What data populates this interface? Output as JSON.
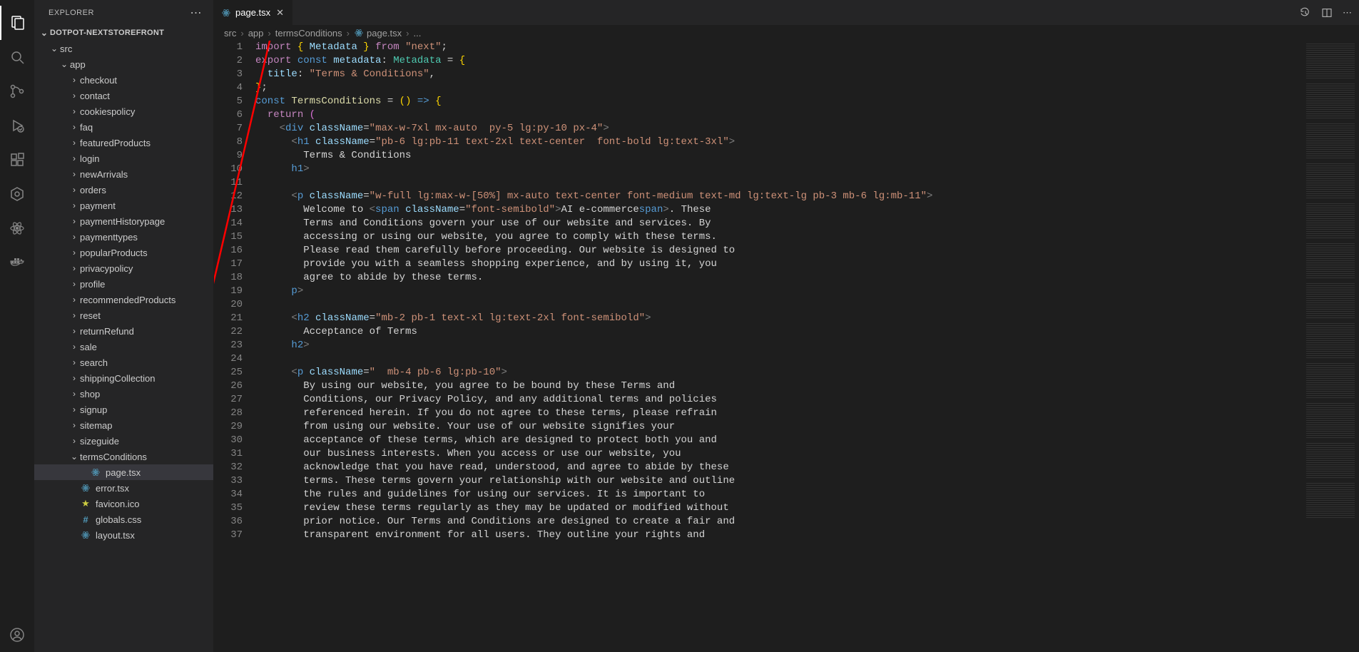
{
  "explorer": {
    "title": "EXPLORER",
    "project": "DOTPOT-NEXTSTOREFRONT",
    "tree": [
      {
        "label": "src",
        "depth": 1,
        "kind": "folder",
        "expanded": true
      },
      {
        "label": "app",
        "depth": 2,
        "kind": "folder",
        "expanded": true
      },
      {
        "label": "checkout",
        "depth": 3,
        "kind": "folder"
      },
      {
        "label": "contact",
        "depth": 3,
        "kind": "folder"
      },
      {
        "label": "cookiespolicy",
        "depth": 3,
        "kind": "folder"
      },
      {
        "label": "faq",
        "depth": 3,
        "kind": "folder"
      },
      {
        "label": "featuredProducts",
        "depth": 3,
        "kind": "folder"
      },
      {
        "label": "login",
        "depth": 3,
        "kind": "folder"
      },
      {
        "label": "newArrivals",
        "depth": 3,
        "kind": "folder"
      },
      {
        "label": "orders",
        "depth": 3,
        "kind": "folder"
      },
      {
        "label": "payment",
        "depth": 3,
        "kind": "folder"
      },
      {
        "label": "paymentHistorypage",
        "depth": 3,
        "kind": "folder"
      },
      {
        "label": "paymenttypes",
        "depth": 3,
        "kind": "folder"
      },
      {
        "label": "popularProducts",
        "depth": 3,
        "kind": "folder"
      },
      {
        "label": "privacypolicy",
        "depth": 3,
        "kind": "folder"
      },
      {
        "label": "profile",
        "depth": 3,
        "kind": "folder"
      },
      {
        "label": "recommendedProducts",
        "depth": 3,
        "kind": "folder"
      },
      {
        "label": "reset",
        "depth": 3,
        "kind": "folder"
      },
      {
        "label": "returnRefund",
        "depth": 3,
        "kind": "folder"
      },
      {
        "label": "sale",
        "depth": 3,
        "kind": "folder"
      },
      {
        "label": "search",
        "depth": 3,
        "kind": "folder"
      },
      {
        "label": "shippingCollection",
        "depth": 3,
        "kind": "folder"
      },
      {
        "label": "shop",
        "depth": 3,
        "kind": "folder"
      },
      {
        "label": "signup",
        "depth": 3,
        "kind": "folder"
      },
      {
        "label": "sitemap",
        "depth": 3,
        "kind": "folder"
      },
      {
        "label": "sizeguide",
        "depth": 3,
        "kind": "folder"
      },
      {
        "label": "termsConditions",
        "depth": 3,
        "kind": "folder",
        "expanded": true
      },
      {
        "label": "page.tsx",
        "depth": 4,
        "kind": "react",
        "selected": true
      },
      {
        "label": "error.tsx",
        "depth": 3,
        "kind": "react"
      },
      {
        "label": "favicon.ico",
        "depth": 3,
        "kind": "favicon"
      },
      {
        "label": "globals.css",
        "depth": 3,
        "kind": "css"
      },
      {
        "label": "layout.tsx",
        "depth": 3,
        "kind": "react"
      }
    ]
  },
  "tab": {
    "label": "page.tsx"
  },
  "breadcrumbs": [
    "src",
    "app",
    "termsConditions",
    "page.tsx",
    "..."
  ],
  "code": {
    "lines": 37,
    "l1_import": "import",
    "l1_brace_o": "{",
    "l1_meta": "Metadata",
    "l1_brace_c": "}",
    "l1_from": "from",
    "l1_next": "\"next\"",
    "l1_semi": ";",
    "l2_export": "export",
    "l2_const": "const",
    "l2_metadata": "metadata",
    "l2_colon": ":",
    "l2_type": "Metadata",
    "l2_eq": " = ",
    "l2_brace": "{",
    "l3_title": "title",
    "l3_colon": ":",
    "l3_str": "\"Terms & Conditions\"",
    "l3_comma": ",",
    "l4": "};",
    "l5_const": "const",
    "l5_name": "TermsConditions",
    "l5_eq": " = ",
    "l5_paren": "()",
    "l5_arrow": " => ",
    "l5_brace": "{",
    "l6_return": "return",
    "l6_paren": " (",
    "l7_open": "<",
    "l7_div": "div",
    "l7_cn": "className",
    "l7_eq": "=",
    "l7_str": "\"max-w-7xl mx-auto  py-5 lg:py-10 px-4\"",
    "l7_close": ">",
    "l8_open": "<",
    "l8_h1": "h1",
    "l8_cn": "className",
    "l8_eq": "=",
    "l8_str": "\"pb-6 lg:pb-11 text-2xl text-center  font-bold lg:text-3xl\"",
    "l8_close": ">",
    "l9": "Terms & Conditions",
    "l10_open": "</",
    "l10_h1": "h1",
    "l10_close": ">",
    "l12_open": "<",
    "l12_p": "p",
    "l12_cn": "className",
    "l12_eq": "=",
    "l12_str": "\"w-full lg:max-w-[50%] mx-auto text-center font-medium text-md lg:text-lg pb-3 mb-6 lg:mb-11\"",
    "l12_close": ">",
    "l13a": "Welcome to ",
    "l13_open": "<",
    "l13_span": "span",
    "l13_cn": "className",
    "l13_eq": "=",
    "l13_str": "\"font-semibold\"",
    "l13_close": ">",
    "l13b": "AI e-commerce",
    "l13_copen": "</",
    "l13_span2": "span",
    "l13_cclose": ">",
    "l13c": ". These",
    "l14": "Terms and Conditions govern your use of our website and services. By",
    "l15": "accessing or using our website, you agree to comply with these terms.",
    "l16": "Please read them carefully before proceeding. Our website is designed to",
    "l17": "provide you with a seamless shopping experience, and by using it, you",
    "l18": "agree to abide by these terms.",
    "l19_open": "</",
    "l19_p": "p",
    "l19_close": ">",
    "l21_open": "<",
    "l21_h2": "h2",
    "l21_cn": "className",
    "l21_eq": "=",
    "l21_str": "\"mb-2 pb-1 text-xl lg:text-2xl font-semibold\"",
    "l21_close": ">",
    "l22": "Acceptance of Terms",
    "l23_open": "</",
    "l23_h2": "h2",
    "l23_close": ">",
    "l25_open": "<",
    "l25_p": "p",
    "l25_cn": "className",
    "l25_eq": "=",
    "l25_str": "\"  mb-4 pb-6 lg:pb-10\"",
    "l25_close": ">",
    "l26": "By using our website, you agree to be bound by these Terms and",
    "l27": "Conditions, our Privacy Policy, and any additional terms and policies",
    "l28": "referenced herein. If you do not agree to these terms, please refrain",
    "l29": "from using our website. Your use of our website signifies your",
    "l30": "acceptance of these terms, which are designed to protect both you and",
    "l31": "our business interests. When you access or use our website, you",
    "l32": "acknowledge that you have read, understood, and agree to abide by these",
    "l33": "terms. These terms govern your relationship with our website and outline",
    "l34": "the rules and guidelines for using our services. It is important to",
    "l35": "review these terms regularly as they may be updated or modified without",
    "l36": "prior notice. Our Terms and Conditions are designed to create a fair and",
    "l37": "transparent environment for all users. They outline your rights and"
  }
}
